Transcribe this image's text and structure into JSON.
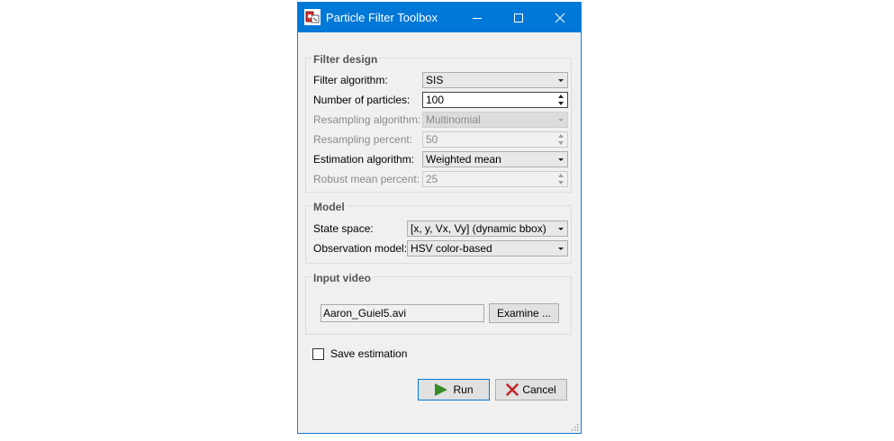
{
  "window": {
    "title": "Particle Filter Toolbox",
    "icon": "app-icon",
    "accent_color": "#0078d7"
  },
  "filter_design": {
    "legend": "Filter design",
    "fields": [
      {
        "label": "Filter algorithm:",
        "value": "SIS",
        "kind": "select",
        "enabled": true
      },
      {
        "label": "Number of particles:",
        "value": "100",
        "kind": "spinner",
        "enabled": true
      },
      {
        "label": "Resampling algorithm:",
        "value": "Multinomial",
        "kind": "select",
        "enabled": false
      },
      {
        "label": "Resampling percent:",
        "value": "50",
        "kind": "spinner",
        "enabled": false
      },
      {
        "label": "Estimation algorithm:",
        "value": "Weighted mean",
        "kind": "select",
        "enabled": true
      },
      {
        "label": "Robust mean percent:",
        "value": "25",
        "kind": "spinner",
        "enabled": false
      }
    ]
  },
  "model": {
    "legend": "Model",
    "fields": [
      {
        "label": "State space:",
        "value": "[x, y, Vx, Vy] (dynamic bbox)",
        "kind": "select",
        "enabled": true
      },
      {
        "label": "Observation model:",
        "value": "HSV color-based",
        "kind": "select",
        "enabled": true
      }
    ]
  },
  "input_video": {
    "legend": "Input video",
    "file": "Aaron_Guiel5.avi",
    "examine_label": "Examine ..."
  },
  "save_estimation": {
    "label": "Save estimation",
    "checked": false
  },
  "actions": {
    "run_label": "Run",
    "cancel_label": "Cancel",
    "run_icon_color": "#3a8a2a",
    "cancel_icon_color": "#c0262d"
  }
}
